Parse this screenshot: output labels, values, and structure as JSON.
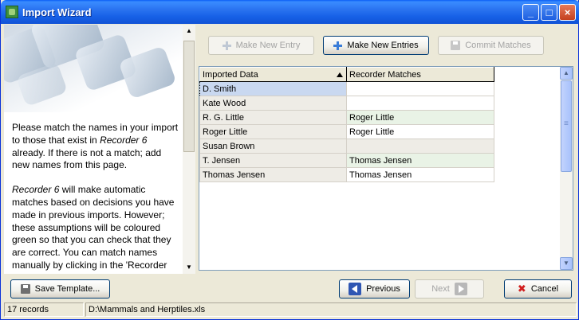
{
  "window": {
    "title": "Import Wizard"
  },
  "side_panel": {
    "paragraph1_parts": [
      "Please match the names in your import to those that exist in ",
      "Recorder 6",
      " already. If there is not a match; add new names from this page."
    ],
    "paragraph2_parts": [
      "Recorder 6",
      " will make automatic matches based on decisions you have made in previous imports. However; these assumptions will be coloured green so that you can check that they are correct. You can match names manually by clicking in the 'Recorder Matches' cells and use the"
    ]
  },
  "toolbar": {
    "make_new_entry": "Make New Entry",
    "make_new_entries": "Make New Entries",
    "commit_matches": "Commit Matches"
  },
  "grid": {
    "columns": [
      "Imported Data",
      "Recorder Matches"
    ],
    "rows": [
      {
        "imported": "D. Smith",
        "match": ""
      },
      {
        "imported": "Kate Wood",
        "match": ""
      },
      {
        "imported": "R. G. Little",
        "match": "Roger Little"
      },
      {
        "imported": "Roger Little",
        "match": "Roger Little"
      },
      {
        "imported": "Susan Brown",
        "match": ""
      },
      {
        "imported": "T. Jensen",
        "match": "Thomas Jensen"
      },
      {
        "imported": "Thomas Jensen",
        "match": "Thomas Jensen"
      }
    ]
  },
  "footer": {
    "save_template": "Save Template...",
    "previous": "Previous",
    "next": "Next",
    "cancel": "Cancel"
  },
  "status": {
    "records": "17 records",
    "file": "D:\\Mammals and Herptiles.xls"
  },
  "colors": {
    "title_blue": "#1660E6",
    "match_green": "#E9F3E6",
    "selected": "#C9D8F0"
  }
}
